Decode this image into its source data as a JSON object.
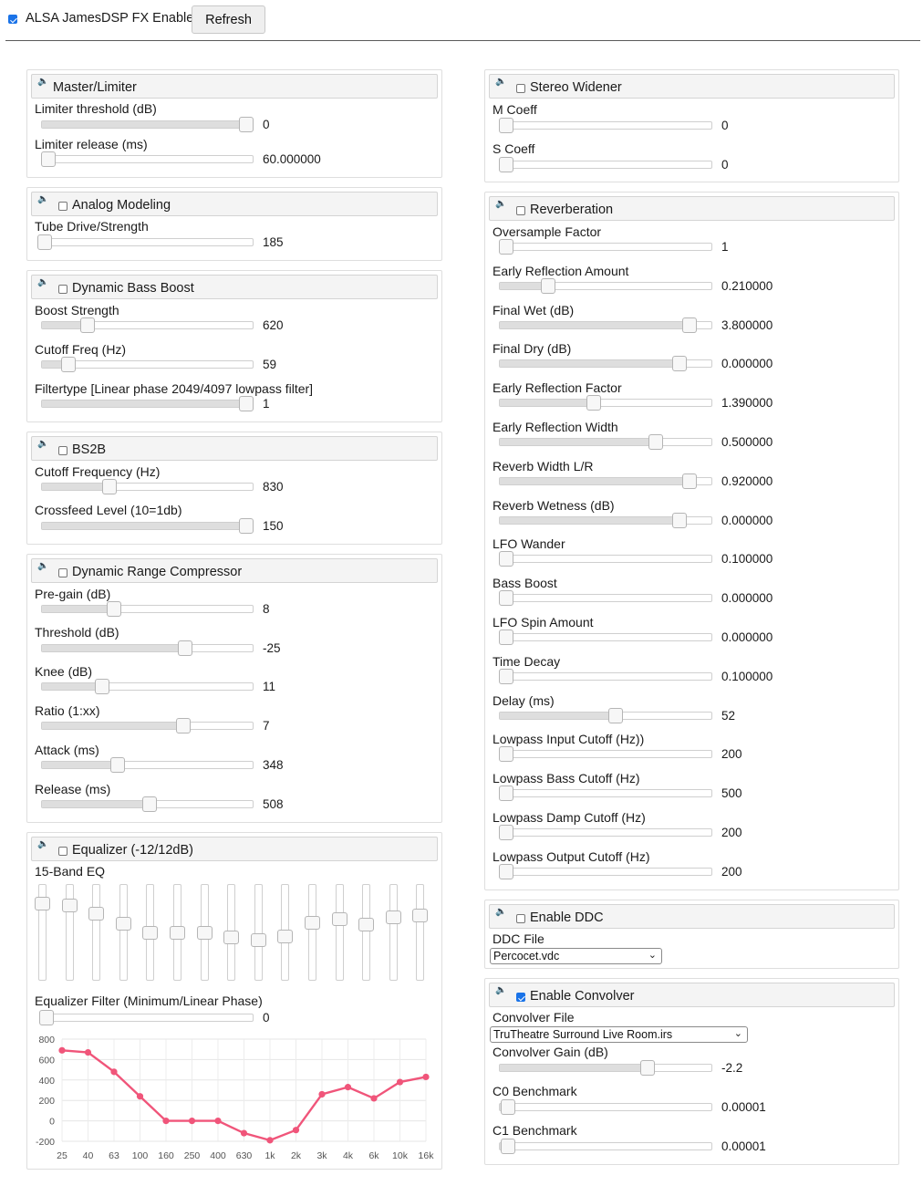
{
  "header": {
    "master_enable_label": "ALSA JamesDSP FX Enable",
    "master_enabled": true,
    "refresh_label": "Refresh"
  },
  "speaker_glyph": "🔈",
  "panels": {
    "master_limiter": {
      "title": "Master/Limiter",
      "sliders": [
        {
          "label": "Limiter threshold (dB)",
          "value": "0",
          "fraction": 1.0
        },
        {
          "label": "Limiter release (ms)",
          "value": "60.000000",
          "fraction": 0.0
        }
      ]
    },
    "analog_modeling": {
      "title": "Analog Modeling",
      "enabled": false,
      "sliders": [
        {
          "label": "Tube Drive/Strength",
          "value": "185",
          "fraction": 0.0
        }
      ]
    },
    "bass_boost": {
      "title": "Dynamic Bass Boost",
      "enabled": false,
      "sliders": [
        {
          "label": "Boost Strength",
          "value": "620",
          "fraction": 0.2
        },
        {
          "label": "Cutoff Freq (Hz)",
          "value": "59",
          "fraction": 0.1
        },
        {
          "label": "Filtertype [Linear phase 2049/4097 lowpass filter]",
          "value": "1",
          "fraction": 1.0
        }
      ]
    },
    "bs2b": {
      "title": "BS2B",
      "enabled": false,
      "sliders": [
        {
          "label": "Cutoff Frequency (Hz)",
          "value": "830",
          "fraction": 0.31
        },
        {
          "label": "Crossfeed Level (10=1db)",
          "value": "150",
          "fraction": 1.0
        }
      ]
    },
    "compressor": {
      "title": "Dynamic Range Compressor",
      "enabled": false,
      "sliders": [
        {
          "label": "Pre-gain (dB)",
          "value": "8",
          "fraction": 0.33
        },
        {
          "label": "Threshold (dB)",
          "value": "-25",
          "fraction": 0.69
        },
        {
          "label": "Knee (dB)",
          "value": "11",
          "fraction": 0.27
        },
        {
          "label": "Ratio (1:xx)",
          "value": "7",
          "fraction": 0.68
        },
        {
          "label": "Attack (ms)",
          "value": "348",
          "fraction": 0.35
        },
        {
          "label": "Release (ms)",
          "value": "508",
          "fraction": 0.51
        }
      ]
    },
    "equalizer": {
      "title": "Equalizer (-12/12dB)",
      "enabled": false,
      "band_label": "15-Band EQ",
      "bands": [
        {
          "level": 0.81
        },
        {
          "level": 0.79
        },
        {
          "level": 0.7
        },
        {
          "level": 0.6
        },
        {
          "level": 0.5
        },
        {
          "level": 0.5
        },
        {
          "level": 0.5
        },
        {
          "level": 0.45
        },
        {
          "level": 0.42
        },
        {
          "level": 0.46
        },
        {
          "level": 0.61
        },
        {
          "level": 0.64
        },
        {
          "level": 0.59
        },
        {
          "level": 0.66
        },
        {
          "level": 0.68
        }
      ],
      "filter_slider": {
        "label": "Equalizer Filter (Minimum/Linear Phase)",
        "value": "0",
        "fraction": 0.0
      }
    },
    "stereo_widener": {
      "title": "Stereo Widener",
      "enabled": false,
      "sliders": [
        {
          "label": "M Coeff",
          "value": "0",
          "fraction": 0.0
        },
        {
          "label": "S Coeff",
          "value": "0",
          "fraction": 0.0
        }
      ]
    },
    "reverb": {
      "title": "Reverberation",
      "enabled": false,
      "sliders": [
        {
          "label": "Oversample Factor",
          "value": "1",
          "fraction": 0.0
        },
        {
          "label": "Early Reflection Amount",
          "value": "0.210000",
          "fraction": 0.21
        },
        {
          "label": "Final Wet (dB)",
          "value": "3.800000",
          "fraction": 0.92
        },
        {
          "label": "Final Dry (dB)",
          "value": "0.000000",
          "fraction": 0.87
        },
        {
          "label": "Early Reflection Factor",
          "value": "1.390000",
          "fraction": 0.44
        },
        {
          "label": "Early Reflection Width",
          "value": "0.500000",
          "fraction": 0.75
        },
        {
          "label": "Reverb Width L/R",
          "value": "0.920000",
          "fraction": 0.92
        },
        {
          "label": "Reverb Wetness (dB)",
          "value": "0.000000",
          "fraction": 0.87
        },
        {
          "label": "LFO Wander",
          "value": "0.100000",
          "fraction": 0.0
        },
        {
          "label": "Bass Boost",
          "value": "0.000000",
          "fraction": 0.0
        },
        {
          "label": "LFO Spin Amount",
          "value": "0.000000",
          "fraction": 0.0
        },
        {
          "label": "Time Decay",
          "value": "0.100000",
          "fraction": 0.0
        },
        {
          "label": "Delay (ms)",
          "value": "52",
          "fraction": 0.55
        },
        {
          "label": "Lowpass Input Cutoff (Hz))",
          "value": "200",
          "fraction": 0.0
        },
        {
          "label": "Lowpass Bass Cutoff (Hz)",
          "value": "500",
          "fraction": 0.0
        },
        {
          "label": "Lowpass Damp Cutoff (Hz)",
          "value": "200",
          "fraction": 0.0
        },
        {
          "label": "Lowpass Output Cutoff (Hz)",
          "value": "200",
          "fraction": 0.0
        }
      ]
    },
    "ddc": {
      "title": "Enable DDC",
      "enabled": false,
      "file_label": "DDC File",
      "file_value": "Percocet.vdc"
    },
    "convolver": {
      "title": "Enable Convolver",
      "enabled": true,
      "file_label": "Convolver File",
      "file_value": "TruTheatre Surround Live Room.irs",
      "sliders": [
        {
          "label": "Convolver Gain (dB)",
          "value": "-2.2",
          "fraction": 0.71
        },
        {
          "label": "C0 Benchmark",
          "value": "0.00001",
          "fraction": 0.01
        },
        {
          "label": "C1 Benchmark",
          "value": "0.00001",
          "fraction": 0.01
        }
      ]
    }
  },
  "chart_data": {
    "type": "line",
    "categories": [
      "25",
      "40",
      "63",
      "100",
      "160",
      "250",
      "400",
      "630",
      "1k",
      "2k",
      "3k",
      "4k",
      "6k",
      "10k",
      "16k"
    ],
    "series": [
      {
        "values": [
          690,
          670,
          480,
          240,
          0,
          0,
          0,
          -120,
          -190,
          -90,
          260,
          330,
          220,
          380,
          430
        ]
      }
    ],
    "yticks": [
      "800",
      "600",
      "400",
      "200",
      "0",
      "-200"
    ],
    "ylim": [
      -200,
      800
    ],
    "grid": true,
    "line_color": "#f0557a"
  }
}
